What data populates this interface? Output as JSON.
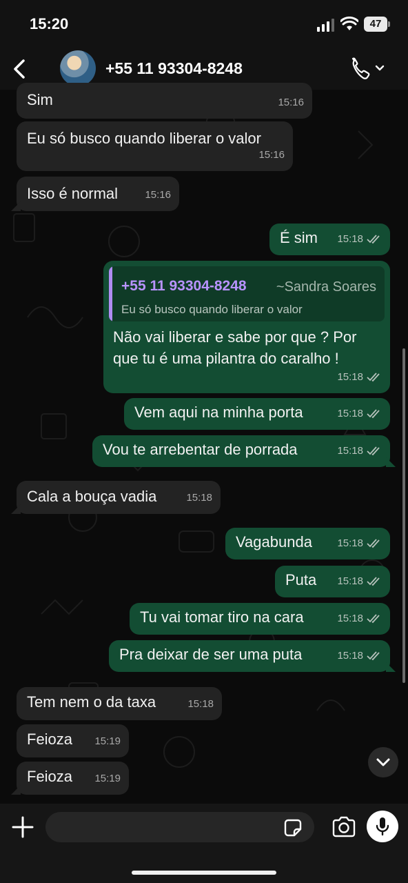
{
  "status_bar": {
    "time": "15:20",
    "battery": "47",
    "icons": [
      "signal-icon",
      "wifi-icon",
      "battery-icon"
    ]
  },
  "header": {
    "contact": "+55 11 93304-8248",
    "icons": [
      "back-icon",
      "avatar",
      "phone-icon",
      "chevron-down-icon"
    ]
  },
  "messages": [
    {
      "dir": "in",
      "text": "Sim",
      "time": "15:16"
    },
    {
      "dir": "in",
      "text": "Eu só busco quando liberar o valor",
      "time": "15:16"
    },
    {
      "dir": "in",
      "text": "Isso é normal",
      "time": "15:16"
    },
    {
      "dir": "out",
      "text": "É sim",
      "time": "15:18",
      "read": true
    },
    {
      "dir": "out",
      "quote": {
        "author": "+55 11 93304-8248",
        "alias": "~Sandra Soares",
        "text": "Eu só busco quando liberar o valor"
      },
      "text_lines": [
        "Não vai liberar e sabe por que ? Por",
        "que tu é uma pilantra do caralho !"
      ],
      "time": "15:18",
      "read": true
    },
    {
      "dir": "out",
      "text": "Vem aqui na minha porta",
      "time": "15:18",
      "read": true
    },
    {
      "dir": "out",
      "text": "Vou te arrebentar de porrada",
      "time": "15:18",
      "read": true
    },
    {
      "dir": "in",
      "text": "Cala a bouça vadia",
      "time": "15:18"
    },
    {
      "dir": "out",
      "text": "Vagabunda",
      "time": "15:18",
      "read": true
    },
    {
      "dir": "out",
      "text": "Puta",
      "time": "15:18",
      "read": true
    },
    {
      "dir": "out",
      "text": "Tu vai tomar tiro na cara",
      "time": "15:18",
      "read": true
    },
    {
      "dir": "out",
      "text": "Pra deixar de ser uma puta",
      "time": "15:18",
      "read": true
    },
    {
      "dir": "in",
      "text": "Tem nem o da taxa",
      "time": "15:18"
    },
    {
      "dir": "in",
      "text": "Feioza",
      "time": "15:19"
    },
    {
      "dir": "in",
      "text": "Feioza",
      "time": "15:19"
    }
  ],
  "input_bar": {
    "placeholder": "",
    "icons": [
      "plus-icon",
      "sticker-icon",
      "camera-icon",
      "mic-icon"
    ]
  },
  "colors": {
    "incoming_bubble": "#232323",
    "outgoing_bubble": "#134d33",
    "quote_accent": "#b08cf2",
    "background": "#0b0b0b"
  }
}
